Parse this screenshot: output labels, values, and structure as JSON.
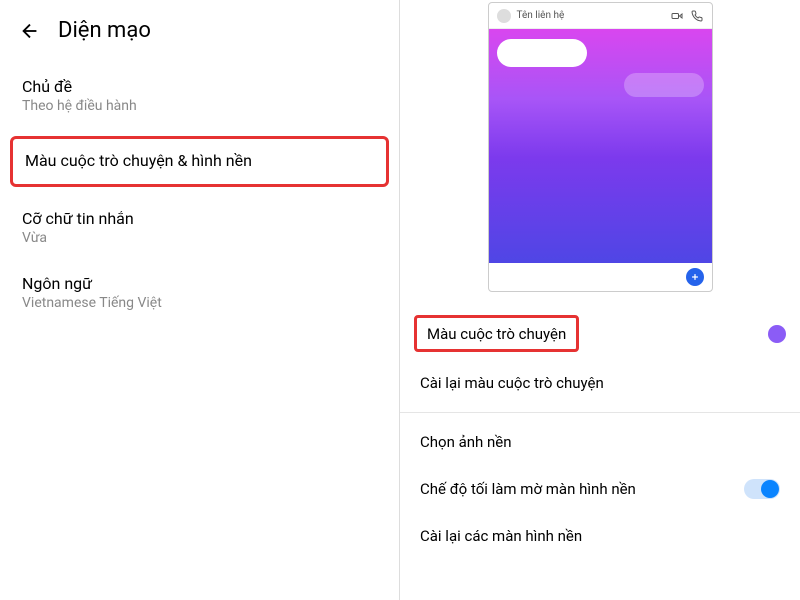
{
  "left": {
    "title": "Diện mạo",
    "items": [
      {
        "title": "Chủ đề",
        "subtitle": "Theo hệ điều hành"
      },
      {
        "title": "Màu cuộc trò chuyện & hình nền"
      },
      {
        "title": "Cỡ chữ tin nhắn",
        "subtitle": "Vừa"
      },
      {
        "title": "Ngôn ngữ",
        "subtitle": "Vietnamese Tiếng Việt"
      }
    ]
  },
  "right": {
    "preview": {
      "contact_name": "Tên liên hệ"
    },
    "options": {
      "chat_color": "Màu cuộc trò chuyện",
      "reset_chat_color": "Cài lại màu cuộc trò chuyện",
      "choose_background": "Chọn ảnh nền",
      "dark_mode_blur": "Chế độ tối làm mờ màn hình nền",
      "reset_backgrounds": "Cài lại các màn hình nền"
    },
    "colors": {
      "swatch": "#8b5cf6",
      "toggle_on": "#0a84ff"
    }
  }
}
